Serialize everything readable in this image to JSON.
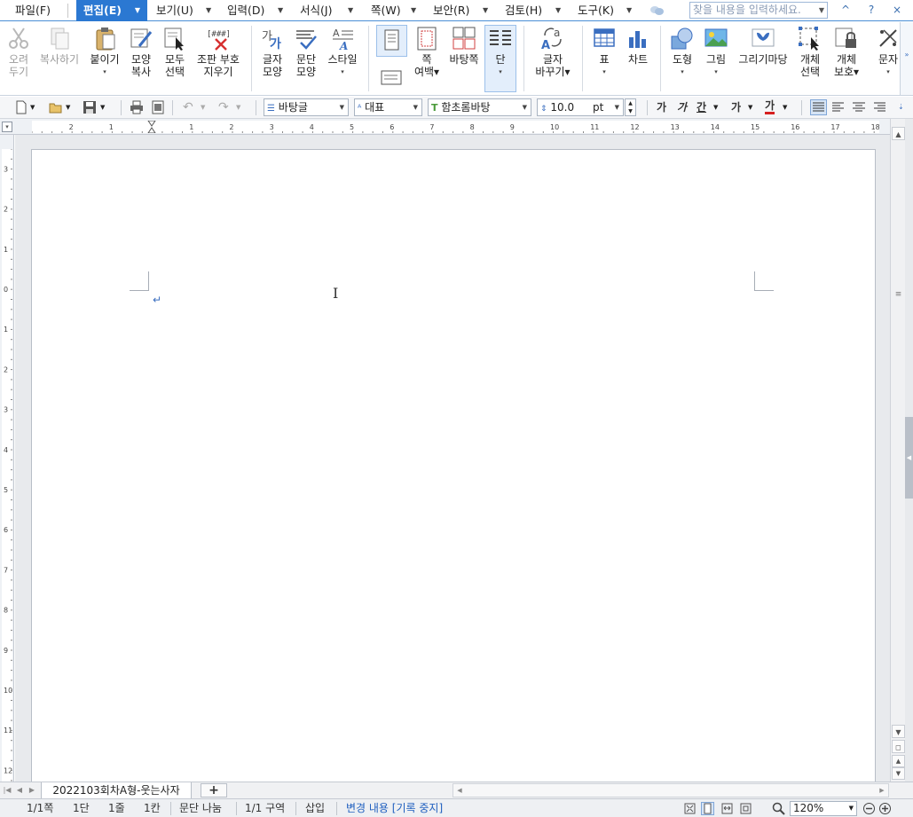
{
  "menubar": {
    "items": [
      {
        "label": "파일(F)"
      },
      {
        "label": "편집(E)"
      },
      {
        "label": "보기(U)"
      },
      {
        "label": "입력(D)"
      },
      {
        "label": "서식(J)"
      },
      {
        "label": "쪽(W)"
      },
      {
        "label": "보안(R)"
      },
      {
        "label": "검토(H)"
      },
      {
        "label": "도구(K)"
      }
    ],
    "active_index": 1,
    "search_placeholder": "찾을 내용을 입력하세요.",
    "window_controls": [
      "^",
      "?",
      "×"
    ]
  },
  "ribbon": {
    "buttons": [
      {
        "label1": "오려",
        "label2": "두기",
        "icon": "scissors-icon",
        "disabled": true
      },
      {
        "label1": "복사하기",
        "label2": "",
        "icon": "copy-icon",
        "disabled": true
      },
      {
        "label1": "붙이기",
        "label2": "▾",
        "icon": "paste-icon",
        "disabled": false
      },
      {
        "label1": "모양",
        "label2": "복사",
        "icon": "format-painter-icon",
        "disabled": false
      },
      {
        "label1": "모두",
        "label2": "선택",
        "icon": "select-all-icon",
        "disabled": false
      },
      {
        "label1": "조판 부호",
        "label2": "지우기",
        "icon": "clear-markup-icon",
        "disabled": false
      },
      {
        "label1": "글자",
        "label2": "모양",
        "icon": "char-shape-icon",
        "disabled": false
      },
      {
        "label1": "문단",
        "label2": "모양",
        "icon": "para-shape-icon",
        "disabled": false
      },
      {
        "label1": "스타일",
        "label2": "▾",
        "icon": "style-icon",
        "disabled": false
      },
      {
        "label1": "쪽",
        "label2": "여백▾",
        "icon": "page-margin-icon",
        "disabled": false
      },
      {
        "label1": "바탕쪽",
        "label2": "",
        "icon": "master-page-icon",
        "disabled": false
      },
      {
        "label1": "단",
        "label2": "▾",
        "icon": "columns-icon",
        "disabled": false
      },
      {
        "label1": "글자",
        "label2": "바꾸기▾",
        "icon": "replace-char-icon",
        "disabled": false
      },
      {
        "label1": "표",
        "label2": "▾",
        "icon": "table-icon",
        "disabled": false
      },
      {
        "label1": "차트",
        "label2": "",
        "icon": "chart-icon",
        "disabled": false
      },
      {
        "label1": "도형",
        "label2": "▾",
        "icon": "shape-icon",
        "disabled": false
      },
      {
        "label1": "그림",
        "label2": "▾",
        "icon": "picture-icon",
        "disabled": false
      },
      {
        "label1": "그리기마당",
        "label2": "",
        "icon": "clipart-icon",
        "disabled": false
      },
      {
        "label1": "개체",
        "label2": "선택",
        "icon": "object-select-icon",
        "disabled": false
      },
      {
        "label1": "개체",
        "label2": "보호▾",
        "icon": "object-protect-icon",
        "disabled": false
      },
      {
        "label1": "문자",
        "label2": "▾",
        "icon": "symbol-icon",
        "disabled": false
      }
    ]
  },
  "toolbar": {
    "style_combo": "바탕글",
    "lang_combo": "대표",
    "font_combo": "함초롬바탕",
    "size_value": "10.0",
    "size_unit": "pt",
    "fmt_buttons": [
      "가",
      "가",
      "간",
      "가",
      "가"
    ]
  },
  "ruler": {
    "h_left_ticks": [
      "2",
      "1"
    ],
    "h_ticks": [
      "1",
      "2",
      "3",
      "4",
      "5",
      "6",
      "7",
      "8",
      "9",
      "10",
      "11",
      "12",
      "13",
      "14",
      "15",
      "16",
      "17",
      "18"
    ],
    "v_ticks": [
      "3",
      "2",
      "1",
      "0",
      "1",
      "2",
      "3",
      "4",
      "5",
      "6",
      "7",
      "8",
      "9",
      "10",
      "11",
      "12"
    ]
  },
  "tabs": {
    "doc_name": "2022103회차A형-웃는사자",
    "add_label": "+"
  },
  "status": {
    "page": "1/1쪽",
    "column": "1단",
    "line": "1줄",
    "col_pos": "1칸",
    "para_break": "문단 나눔",
    "section": "1/1 구역",
    "mode": "삽입",
    "track": "변경 내용 [기록 중지]",
    "zoom": "120%"
  }
}
